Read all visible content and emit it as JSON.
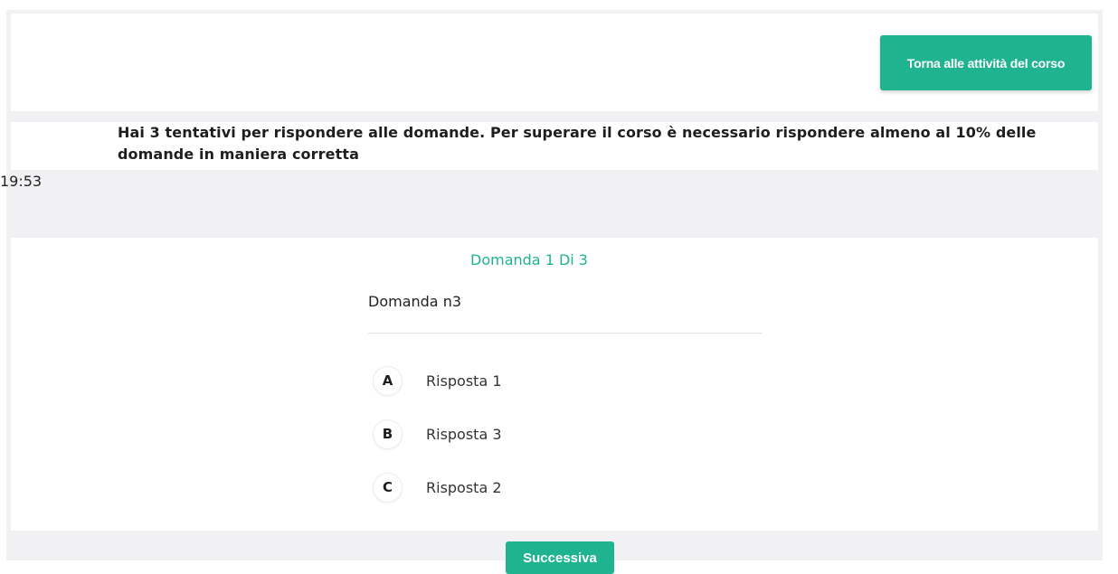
{
  "header": {
    "back_button_label": "Torna alle attività del corso"
  },
  "info": {
    "text": "Hai 3 tentativi per rispondere alle domande. Per superare il corso è necessario rispondere almeno al 10% delle domande in maniera corretta"
  },
  "timer": {
    "value": "19:53"
  },
  "question": {
    "counter": "Domanda 1 Di 3",
    "text": "Domanda n3",
    "answers": [
      {
        "letter": "A",
        "label": "Risposta 1"
      },
      {
        "letter": "B",
        "label": "Risposta 3"
      },
      {
        "letter": "C",
        "label": "Risposta 2"
      }
    ]
  },
  "footer": {
    "next_button_label": "Successiva"
  },
  "colors": {
    "accent": "#1fb390",
    "background": "#f1f1f4"
  }
}
